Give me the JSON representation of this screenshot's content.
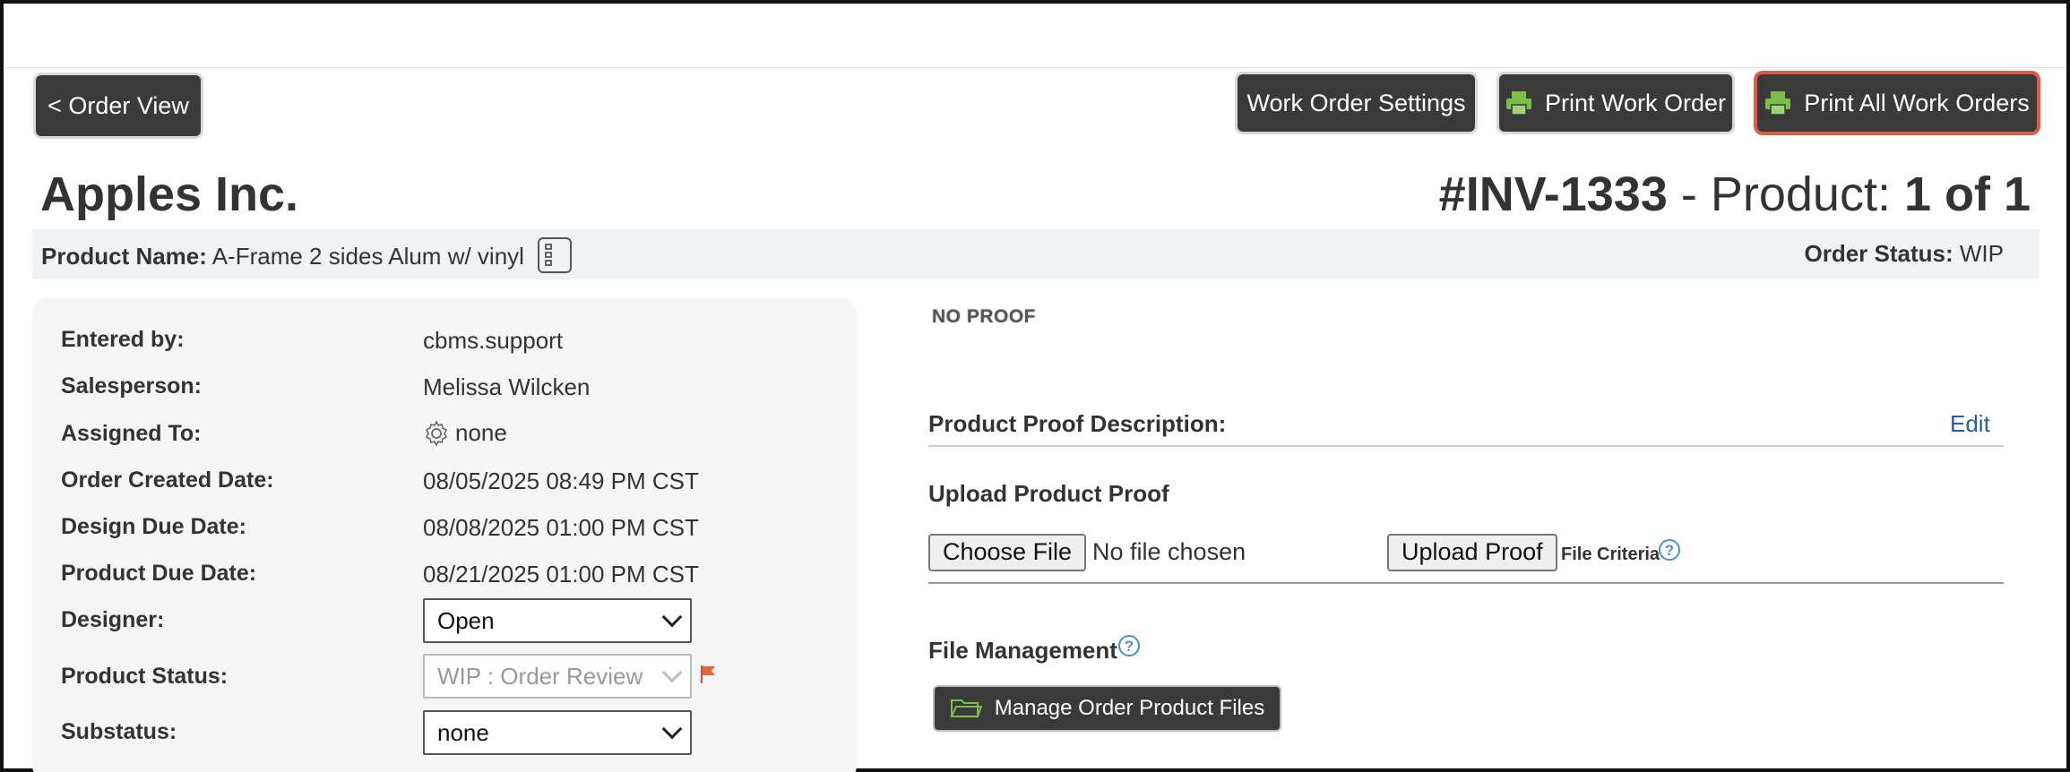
{
  "toolbar": {
    "back_label": "< Order View",
    "settings_label": "Work Order Settings",
    "print_label": "Print Work Order",
    "print_all_label": "Print All Work Orders"
  },
  "header": {
    "company": "Apples Inc.",
    "invoice": "#INV-1333",
    "product_sep": " - Product: ",
    "product_count": "1 of 1"
  },
  "product_info": {
    "name_label": "Product Name:",
    "name_value": "A-Frame 2 sides Alum w/ vinyl",
    "status_label": "Order Status:",
    "status_value": "WIP"
  },
  "details": {
    "entered_by": {
      "label": "Entered by:",
      "value": "cbms.support"
    },
    "salesperson": {
      "label": "Salesperson:",
      "value": "Melissa Wilcken"
    },
    "assigned_to": {
      "label": "Assigned To:",
      "value": "none"
    },
    "created": {
      "label": "Order Created Date:",
      "value": "08/05/2025 08:49 PM CST"
    },
    "design_due": {
      "label": "Design Due Date:",
      "value": "08/08/2025 01:00 PM CST"
    },
    "product_due": {
      "label": "Product Due Date:",
      "value": "08/21/2025 01:00 PM CST"
    },
    "designer": {
      "label": "Designer:",
      "value": "Open"
    },
    "product_status": {
      "label": "Product Status:",
      "value": "WIP : Order Review"
    },
    "substatus": {
      "label": "Substatus:",
      "value": "none"
    }
  },
  "proof": {
    "no_proof": "NO PROOF",
    "description_label": "Product Proof Description:",
    "edit_label": "Edit",
    "upload_heading": "Upload Product Proof",
    "choose_file_label": "Choose File",
    "no_file_text": "No file chosen",
    "upload_button_label": "Upload Proof",
    "file_criteria": "File Criteria",
    "file_mgmt_label": "File Management",
    "manage_files_label": "Manage Order Product Files"
  },
  "colors": {
    "dark_button": "#3a3a3a",
    "printer_icon": "#7bbf4a",
    "highlight_border": "#e05a47",
    "link": "#2a5d9a",
    "help_icon": "#4a8fd6",
    "flag": "#e0683f"
  }
}
